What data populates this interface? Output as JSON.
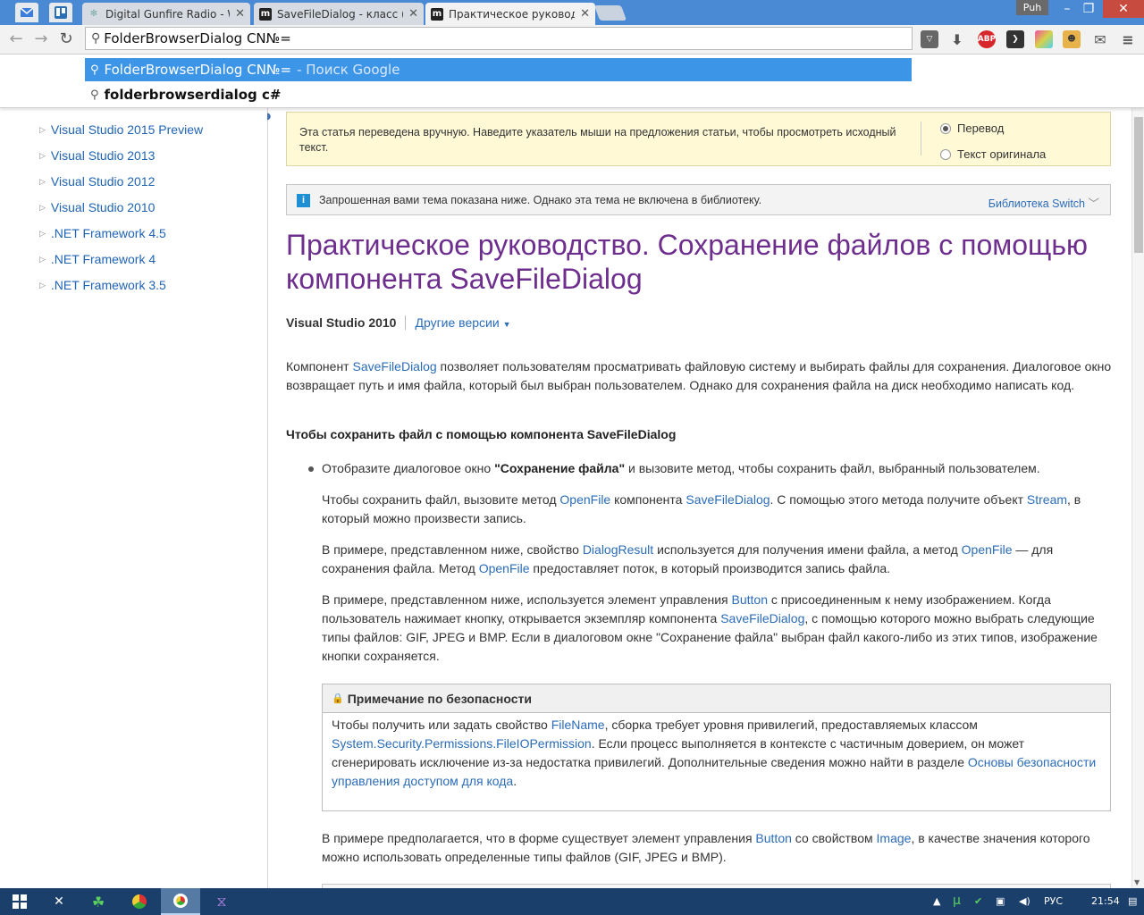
{
  "browser": {
    "tabs": [
      {
        "title": "Digital Gunfire Radio - We",
        "favicon": "gear-radio-icon"
      },
      {
        "title": "SaveFileDialog - класс (Sy",
        "favicon": "m"
      },
      {
        "title": "Практическое руководст",
        "favicon": "m",
        "active": true
      }
    ],
    "profile": "Puh",
    "address": "FolderBrowserDialog CN№=",
    "dropdown": {
      "selected_text": "FolderBrowserDialog CN№=",
      "selected_hint": "- Поиск Google",
      "other_text": "folderbrowserdialog c#"
    },
    "extensions": [
      "pocket-icon",
      "download-icon",
      "adblock-icon",
      "evernote-icon",
      "gradient-icon",
      "face-icon",
      "mail-icon",
      "menu-icon"
    ],
    "adblock_label": "ABP"
  },
  "sidebar": {
    "items": [
      "Visual Studio 2015 Preview",
      "Visual Studio 2013",
      "Visual Studio 2012",
      "Visual Studio 2010",
      ".NET Framework 4.5",
      ".NET Framework 4",
      ".NET Framework 3.5"
    ]
  },
  "translation": {
    "notice": "Эта статья переведена вручную. Наведите указатель мыши на предложения статьи, чтобы просмотреть исходный текст.",
    "option_translation": "Перевод",
    "option_original": "Текст оригинала"
  },
  "info": {
    "text": "Запрошенная вами тема показана ниже. Однако эта тема не включена в библиотеку.",
    "switch": "Библиотека Switch"
  },
  "article": {
    "title": "Практическое руководство. Сохранение файлов с помощью компонента SaveFileDialog",
    "version": "Visual Studio 2010",
    "other_versions": "Другие версии",
    "intro_a": "Компонент ",
    "intro_link": "SaveFileDialog",
    "intro_b": " позволяет пользователям просматривать файловую систему и выбирать файлы для сохранения. Диалоговое окно возвращает путь и имя файла, который был выбран пользователем. Однако для сохранения файла на диск необходимо написать код.",
    "heading": "Чтобы сохранить файл с помощью компонента SaveFileDialog",
    "step1_a": "Отобразите диалоговое окно ",
    "step1_b": "\"Сохранение файла\"",
    "step1_c": " и вызовите метод, чтобы сохранить файл, выбранный пользователем.",
    "p2_a": "Чтобы сохранить файл, вызовите метод ",
    "p2_l1": "OpenFile",
    "p2_b": " компонента ",
    "p2_l2": "SaveFileDialog",
    "p2_c": ". С помощью этого метода получите объект ",
    "p2_l3": "Stream",
    "p2_d": ", в который можно произвести запись.",
    "p3_a": "В примере, представленном ниже, свойство ",
    "p3_l1": "DialogResult",
    "p3_b": " используется для получения имени файла, а метод ",
    "p3_l2": "OpenFile",
    "p3_c": " — для сохранения файла. Метод ",
    "p3_l3": "OpenFile",
    "p3_d": " предоставляет поток, в который производится запись файла.",
    "p4_a": "В примере, представленном ниже, используется элемент управления ",
    "p4_l1": "Button",
    "p4_b": " с присоединенным к нему изображением. Когда пользователь нажимает кнопку, открывается экземпляр компонента ",
    "p4_l2": "SaveFileDialog",
    "p4_c": ", с помощью которого можно выбрать следующие типы файлов: GIF, JPEG и BMP. Если в диалоговом окне \"Сохранение файла\" выбран файл какого-либо из этих типов, изображение кнопки сохраняется.",
    "security_title": "Примечание по безопасности",
    "sec_a": "Чтобы получить или задать свойство ",
    "sec_l1": "FileName",
    "sec_b": ", сборка требует уровня привилегий, предоставляемых классом ",
    "sec_l2": "System.Security.Permissions.FileIOPermission",
    "sec_c": ". Если процесс выполняется в контексте с частичным доверием, он может сгенерировать исключение из-за недостатка привилегий. Дополнительные сведения можно найти в разделе ",
    "sec_l3": "Основы безопасности управления доступом для кода",
    "sec_d": ".",
    "p5_a": "В примере предполагается, что в форме существует элемент управления ",
    "p5_l1": "Button",
    "p5_b": " со свойством ",
    "p5_l2": "Image",
    "p5_c": ", в качестве значения которого можно использовать определенные типы файлов (GIF, JPEG и BMP)."
  },
  "taskbar": {
    "language": "РУС",
    "time": "21:54"
  }
}
